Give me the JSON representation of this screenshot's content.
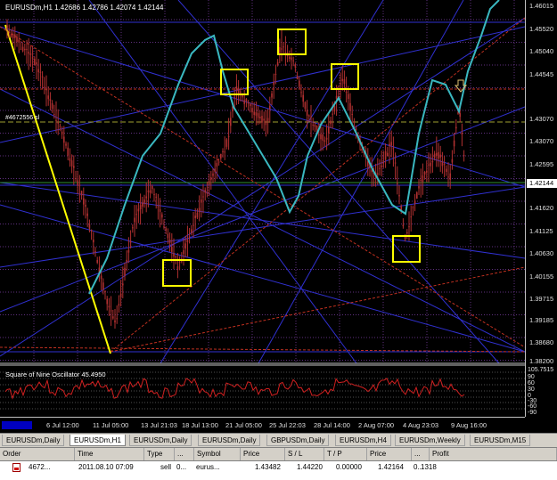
{
  "chart": {
    "title": "EURUSDm,H1  1.42686 1.42786 1.42074 1.42144",
    "hline_label": "#4672556 sl",
    "price_ticks": [
      "1.46015",
      "1.45520",
      "1.45040",
      "1.44545",
      "1.43070",
      "1.43070",
      "1.42595",
      "1.42144",
      "1.41620",
      "1.41125",
      "1.40630",
      "1.40155",
      "1.39715",
      "1.39185",
      "1.38680",
      "1.38200"
    ],
    "current_price": "1.42144",
    "time_ticks": [
      "6 Jul 12:00",
      "11 Jul 05:00",
      "13 Jul 21:03",
      "18 Jul 13:00",
      "21 Jul 05:00",
      "25 Jul 22:03",
      "28 Jul 14:00",
      "2 Aug 07:00",
      "4 Aug 23:03",
      "9 Aug 16:00"
    ],
    "colors": {
      "background": "#000000",
      "candles": "#b03030",
      "oscillator_line": "#3ab8c0",
      "box": "#ffff00",
      "gann_lines": "#3030d0",
      "fib_lines": "#c03020",
      "grid": "#603080",
      "trend_line": "#ffff00"
    }
  },
  "oscillator": {
    "title": "Square of Nine Oscillator 45.4950",
    "levels": [
      "105.7515",
      "90",
      "60",
      "30",
      "0",
      "-30",
      "-60",
      "-90"
    ]
  },
  "tabs": [
    {
      "label": "EURUSDm,Daily"
    },
    {
      "label": "EURUSDm,H1"
    },
    {
      "label": "EURUSDm,Daily"
    },
    {
      "label": "EURUSDm,Daily"
    },
    {
      "label": "GBPUSDm,Daily"
    },
    {
      "label": "EURUSDm,H4"
    },
    {
      "label": "EURUSDm,Weekly"
    },
    {
      "label": "EURUSDm,M15"
    }
  ],
  "terminal": {
    "headers": [
      "Order",
      "Time",
      "Type",
      "...",
      "Symbol",
      "Price",
      "S / L",
      "T / P",
      "Price",
      "...",
      "Profit"
    ],
    "row": {
      "order": "4672...",
      "time": "2011.08.10 07:09",
      "type": "sell",
      "size": "0...",
      "symbol": "eurus...",
      "price": "1.43482",
      "sl": "1.44220",
      "tp": "0.00000",
      "cur_price": "1.42164",
      "commission": "0...",
      "profit": "1318"
    }
  }
}
